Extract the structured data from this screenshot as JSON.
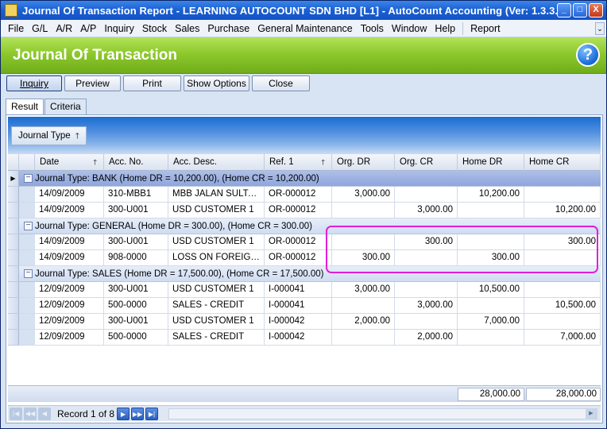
{
  "window": {
    "title": "Journal Of Transaction Report - LEARNING AUTOCOUNT SDN BHD [L1] - AutoCount Accounting (Ver: 1.3.3.6)",
    "minimize_glyph": "_",
    "maximize_glyph": "□",
    "close_glyph": "X"
  },
  "menu": {
    "items": [
      "File",
      "G/L",
      "A/R",
      "A/P",
      "Inquiry",
      "Stock",
      "Sales",
      "Purchase",
      "General Maintenance",
      "Tools",
      "Window",
      "Help"
    ],
    "extra": "Report",
    "chevron": "⌄"
  },
  "banner": {
    "title": "Journal Of Transaction",
    "help_glyph": "?"
  },
  "toolbar": {
    "inquiry": "Inquiry",
    "preview": "Preview",
    "print": "Print",
    "show_options": "Show Options",
    "close": "Close"
  },
  "tabs": {
    "result": "Result",
    "criteria": "Criteria"
  },
  "grouping": {
    "label": "Journal Type",
    "sort_glyph": "🡑"
  },
  "columns": {
    "date": "Date",
    "acc_no": "Acc. No.",
    "acc_desc": "Acc. Desc.",
    "ref1": "Ref. 1",
    "org_dr": "Org. DR",
    "org_cr": "Org. CR",
    "home_dr": "Home DR",
    "home_cr": "Home CR",
    "sort_glyph": "🡑"
  },
  "groups": [
    {
      "label": "Journal Type: BANK (Home DR = 10,200.00), (Home CR = 10,200.00)",
      "rows": [
        {
          "date": "14/09/2009",
          "acc_no": "310-MBB1",
          "acc_desc": "MBB JALAN SULTAN",
          "ref1": "OR-000012",
          "org_dr": "3,000.00",
          "org_cr": "",
          "home_dr": "10,200.00",
          "home_cr": ""
        },
        {
          "date": "14/09/2009",
          "acc_no": "300-U001",
          "acc_desc": "USD CUSTOMER 1",
          "ref1": "OR-000012",
          "org_dr": "",
          "org_cr": "3,000.00",
          "home_dr": "",
          "home_cr": "10,200.00"
        }
      ]
    },
    {
      "label": "Journal Type: GENERAL (Home DR = 300.00), (Home CR = 300.00)",
      "rows": [
        {
          "date": "14/09/2009",
          "acc_no": "300-U001",
          "acc_desc": "USD CUSTOMER 1",
          "ref1": "OR-000012",
          "org_dr": "",
          "org_cr": "300.00",
          "home_dr": "",
          "home_cr": "300.00"
        },
        {
          "date": "14/09/2009",
          "acc_no": "908-0000",
          "acc_desc": "LOSS ON FOREIGN E...",
          "ref1": "OR-000012",
          "org_dr": "300.00",
          "org_cr": "",
          "home_dr": "300.00",
          "home_cr": ""
        }
      ]
    },
    {
      "label": "Journal Type: SALES (Home DR = 17,500.00), (Home CR = 17,500.00)",
      "rows": [
        {
          "date": "12/09/2009",
          "acc_no": "300-U001",
          "acc_desc": "USD CUSTOMER 1",
          "ref1": "I-000041",
          "org_dr": "3,000.00",
          "org_cr": "",
          "home_dr": "10,500.00",
          "home_cr": ""
        },
        {
          "date": "12/09/2009",
          "acc_no": "500-0000",
          "acc_desc": "SALES - CREDIT",
          "ref1": "I-000041",
          "org_dr": "",
          "org_cr": "3,000.00",
          "home_dr": "",
          "home_cr": "10,500.00"
        },
        {
          "date": "12/09/2009",
          "acc_no": "300-U001",
          "acc_desc": "USD CUSTOMER 1",
          "ref1": "I-000042",
          "org_dr": "2,000.00",
          "org_cr": "",
          "home_dr": "7,000.00",
          "home_cr": ""
        },
        {
          "date": "12/09/2009",
          "acc_no": "500-0000",
          "acc_desc": "SALES - CREDIT",
          "ref1": "I-000042",
          "org_dr": "",
          "org_cr": "2,000.00",
          "home_dr": "",
          "home_cr": "7,000.00"
        }
      ]
    }
  ],
  "totals": {
    "home_dr": "28,000.00",
    "home_cr": "28,000.00"
  },
  "navigator": {
    "record_text": "Record 1 of 8"
  },
  "colors": {
    "highlight": "#e020d8",
    "banner_green": "#8dc92c",
    "title_blue": "#1a5fd2"
  }
}
